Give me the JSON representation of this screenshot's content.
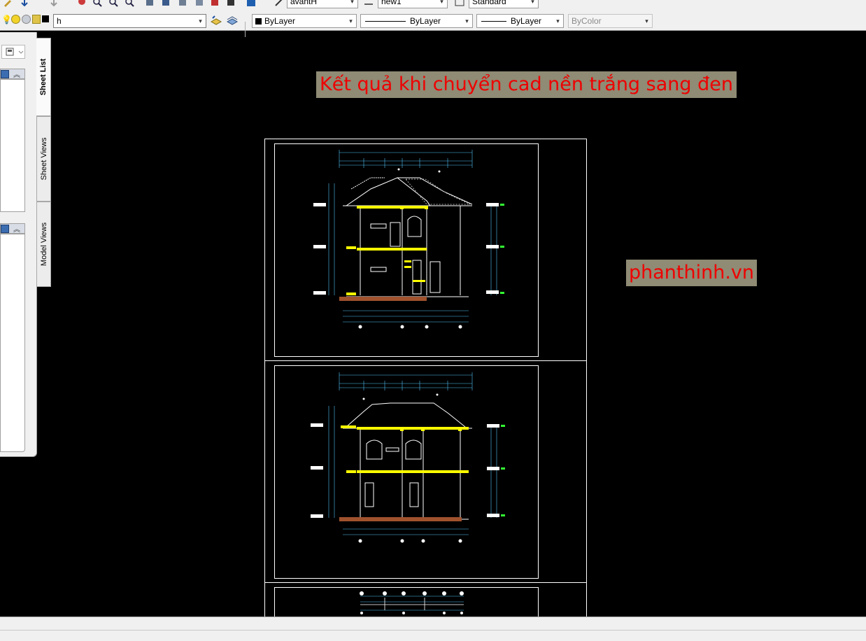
{
  "toolbar": {
    "text_style": "avantH",
    "dim_style": "new1",
    "table_style": "Standard",
    "layer_name": "h",
    "color": "ByLayer",
    "linetype": "ByLayer",
    "lineweight": "ByLayer",
    "plot_style": "ByColor"
  },
  "sheet_set_manager": {
    "tabs": [
      "Sheet List",
      "Sheet Views",
      "Model Views"
    ],
    "active_tab": "Sheet List"
  },
  "canvas": {
    "background": "#000000",
    "title_text": "Kết quả khi chuyển cad nền trắng sang đen",
    "watermark_text": "phanthinh.vn",
    "banner_bg": "#8f8b74",
    "banner_text_color": "#ee0000"
  },
  "drawing": {
    "sheet_count_visible": 3,
    "line_color": "#ffffff",
    "dimension_color": "#4fc3f7",
    "slab_color": "#ffff00",
    "marker_color": "#33ff33"
  }
}
